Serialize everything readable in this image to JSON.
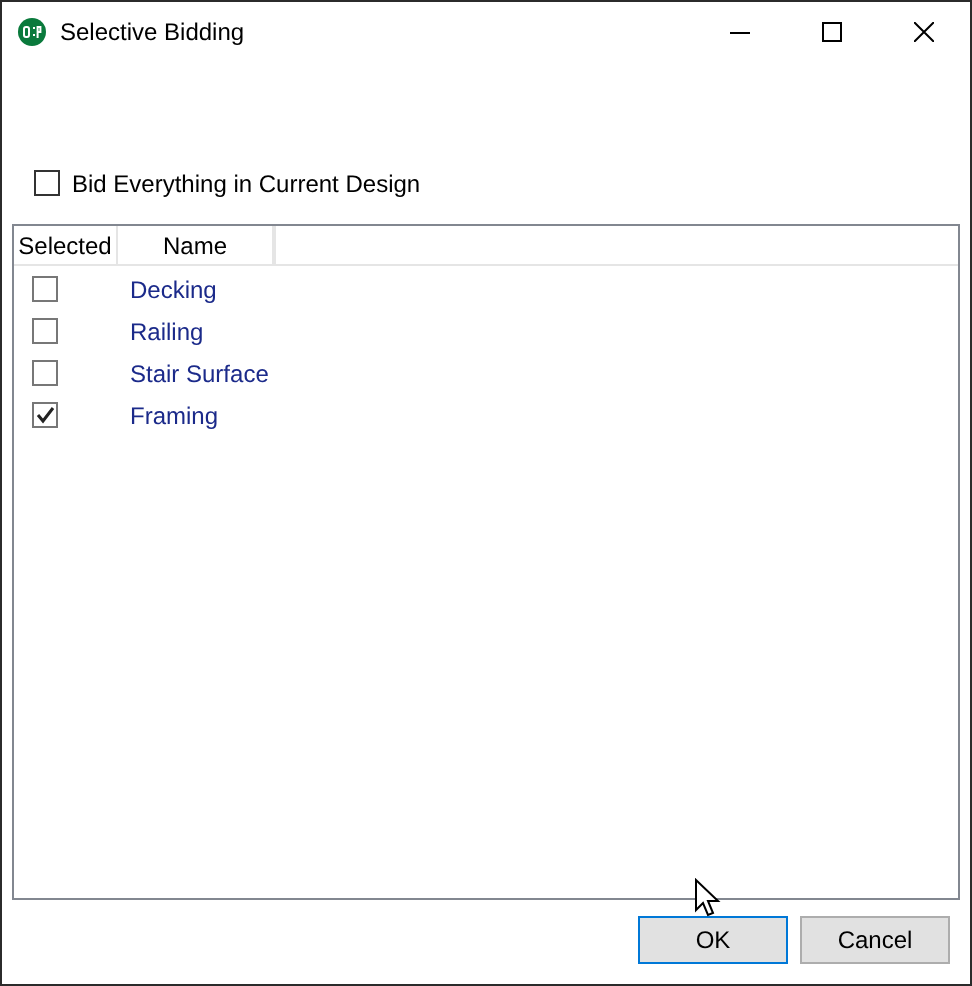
{
  "window": {
    "title": "Selective Bidding"
  },
  "bid_everything": {
    "label": "Bid Everything in Current Design",
    "checked": false
  },
  "table": {
    "columns": [
      "Selected",
      "Name"
    ],
    "rows": [
      {
        "name": "Decking",
        "checked": false
      },
      {
        "name": "Railing",
        "checked": false
      },
      {
        "name": "Stair Surface",
        "checked": false
      },
      {
        "name": "Framing",
        "checked": true
      }
    ]
  },
  "buttons": [
    {
      "label": "OK",
      "kind": "default"
    },
    {
      "label": "Cancel",
      "kind": "normal"
    }
  ]
}
